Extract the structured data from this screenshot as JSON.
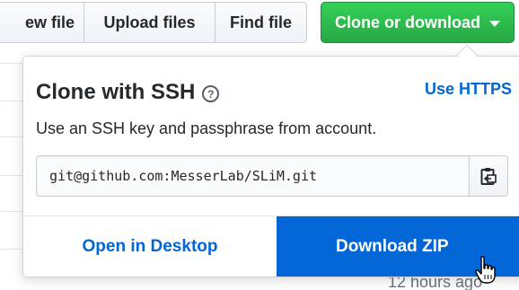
{
  "toolbar": {
    "new_file_label": "ew file",
    "upload_label": "Upload files",
    "find_label": "Find file",
    "clone_label": "Clone or download"
  },
  "dropdown": {
    "title": "Clone with SSH",
    "help_glyph": "?",
    "switch_link": "Use HTTPS",
    "description": "Use an SSH key and passphrase from account.",
    "clone_url": "git@github.com:MesserLab/SLiM.git",
    "open_desktop_label": "Open in Desktop",
    "download_zip_label": "Download ZIP"
  },
  "background": {
    "timestamp": "12 hours ago"
  },
  "colors": {
    "clone_green": "#28a745",
    "link_blue": "#0366d6",
    "download_blue": "#0366d6"
  },
  "icons": [
    "help-icon",
    "caret-down-icon",
    "clipboard-icon",
    "hand-cursor-icon"
  ]
}
